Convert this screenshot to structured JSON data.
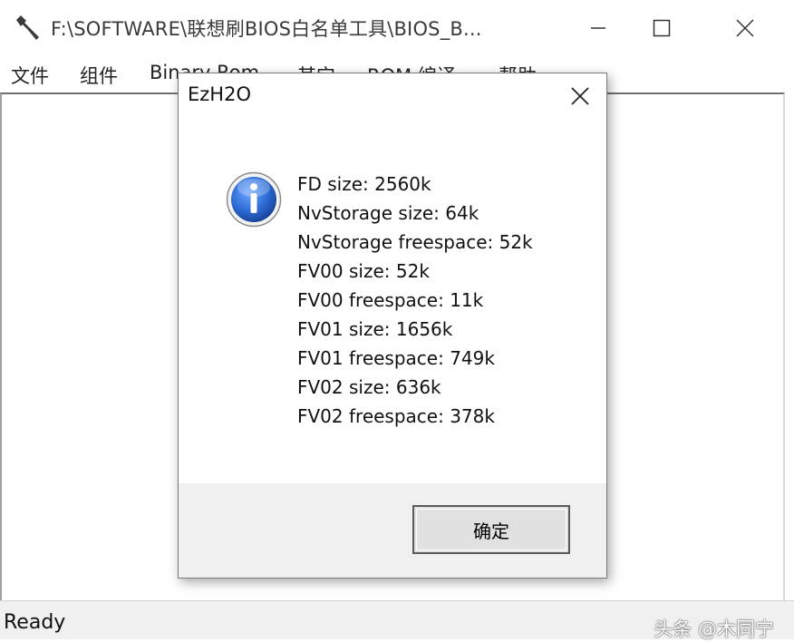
{
  "window": {
    "title": "F:\\SOFTWARE\\联想刷BIOS白名单工具\\BIOS_B...",
    "menu": [
      "文件",
      "组件",
      "Binary Rom",
      "其它",
      "ROM 编译",
      "帮助"
    ],
    "status": "Ready",
    "watermark": "头条 @木同宁"
  },
  "dialog": {
    "title": "EzH2O",
    "icon": "info-icon",
    "lines": [
      "FD size: 2560k",
      "NvStorage size: 64k",
      "NvStorage freespace: 52k",
      "FV00 size: 52k",
      "FV00 freespace: 11k",
      "FV01 size: 1656k",
      "FV01 freespace: 749k",
      "FV02 size: 636k",
      "FV02 freespace: 378k"
    ],
    "ok_label": "确定"
  },
  "colors": {
    "icon_blue": "#2f6fd8",
    "dialog_footer": "#f0f0f0"
  }
}
